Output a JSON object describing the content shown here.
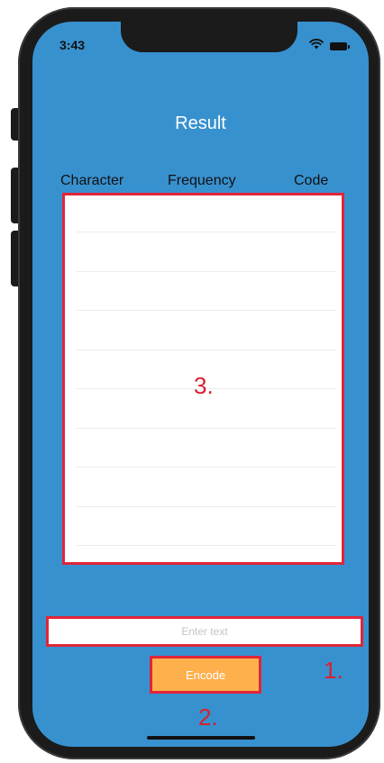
{
  "status_bar": {
    "time": "3:43",
    "wifi_icon": "wifi-icon",
    "battery_icon": "battery-icon"
  },
  "screen": {
    "title": "Result",
    "background_color": "#3891cf"
  },
  "table": {
    "columns": [
      "Character",
      "Frequency",
      "Code"
    ],
    "rows": [],
    "annotation": "3."
  },
  "input": {
    "placeholder": "Enter text",
    "value": "",
    "annotation": "1."
  },
  "encode_button": {
    "label": "Encode",
    "color": "#fdb04c",
    "annotation": "2."
  },
  "annotation_color": "#e0253a"
}
